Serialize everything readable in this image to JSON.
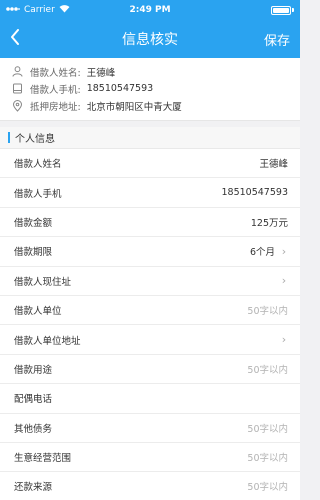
{
  "statusbar": {
    "carrier": "Carrier",
    "time": "2:49 PM"
  },
  "navbar": {
    "title": "信息核实",
    "save_label": "保存"
  },
  "summary": [
    {
      "icon": "person-icon",
      "label": "借款人姓名:",
      "value": "王德峰"
    },
    {
      "icon": "phone-icon",
      "label": "借款人手机:",
      "value": "18510547593"
    },
    {
      "icon": "location-pin-icon",
      "label": "抵押房地址:",
      "value": "北京市朝阳区中青大厦"
    }
  ],
  "section": {
    "title": "个人信息"
  },
  "fields": [
    {
      "label": "借款人姓名",
      "value": "王德峰"
    },
    {
      "label": "借款人手机",
      "value": "18510547593"
    },
    {
      "label": "借款金额",
      "value": "125万元"
    },
    {
      "label": "借款期限",
      "value": "6个月",
      "chevron": true
    },
    {
      "label": "借款人现住址",
      "value": "",
      "chevron": true
    },
    {
      "label": "借款人单位",
      "placeholder": "50字以内"
    },
    {
      "label": "借款人单位地址",
      "value": "",
      "chevron": true
    },
    {
      "label": "借款用途",
      "placeholder": "50字以内"
    },
    {
      "label": "配偶电话",
      "value": ""
    },
    {
      "label": "其他债务",
      "placeholder": "50字以内"
    },
    {
      "label": "生意经营范围",
      "placeholder": "50字以内"
    },
    {
      "label": "还款来源",
      "placeholder": "50字以内"
    }
  ],
  "colors": {
    "accent": "#2aa3f0"
  }
}
